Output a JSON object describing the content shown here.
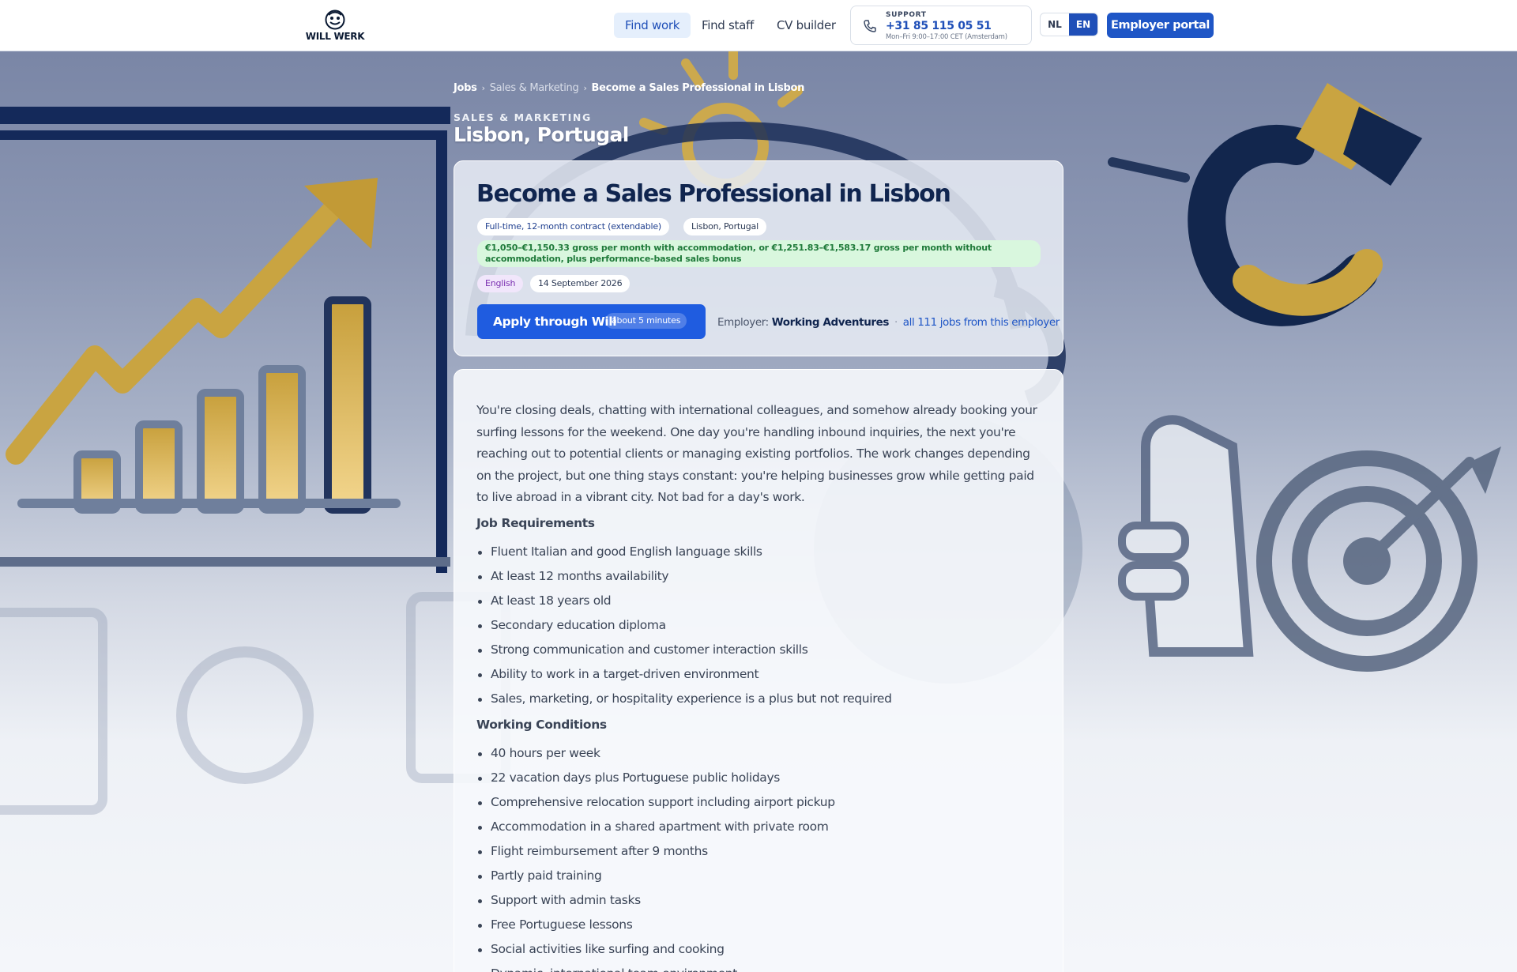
{
  "header": {
    "logo_text": "WILL WERK",
    "nav": [
      {
        "label": "Find work",
        "active": true
      },
      {
        "label": "Find staff",
        "active": false
      },
      {
        "label": "CV builder",
        "active": false
      }
    ],
    "support": {
      "label": "SUPPORT",
      "phone": "+31 85 115 05 51",
      "hours": "Mon–Fri 9:00–17:00 CET (Amsterdam)"
    },
    "languages": [
      "NL",
      "EN"
    ],
    "active_language": "EN",
    "employer_portal": "Employer portal"
  },
  "breadcrumb": {
    "jobs": "Jobs",
    "category": "Sales & Marketing",
    "current": "Become a Sales Professional in Lisbon",
    "separator": "›"
  },
  "hero": {
    "category": "SALES & MARKETING",
    "location": "Lisbon, Portugal"
  },
  "job": {
    "title": "Become a Sales Professional in Lisbon",
    "contract": "Full-time, 12-month contract (extendable)",
    "location": "Lisbon, Portugal",
    "salary": "€1,050–€1,150.33 gross per month with accommodation, or €1,251.83–€1,583.17 gross per month without accommodation, plus performance-based sales bonus",
    "language": "English",
    "date": "14 September 2026",
    "apply_label": "Apply through Will",
    "apply_time": "about 5 minutes",
    "employer_prefix": "Employer:",
    "employer_name": "Working Adventures",
    "employer_separator": "·",
    "employer_jobs": "all 111 jobs from this employer"
  },
  "description": {
    "intro": "You're closing deals, chatting with international colleagues, and somehow already booking your surfing lessons for the weekend. One day you're handling inbound inquiries, the next you're reaching out to potential clients or managing existing portfolios. The work changes depending on the project, but one thing stays constant: you're helping businesses grow while getting paid to live abroad in a vibrant city. Not bad for a day's work.",
    "requirements_heading": "Job Requirements",
    "requirements": [
      "Fluent Italian and good English language skills",
      "At least 12 months availability",
      "At least 18 years old",
      "Secondary education diploma",
      "Strong communication and customer interaction skills",
      "Ability to work in a target-driven environment",
      "Sales, marketing, or hospitality experience is a plus but not required"
    ],
    "conditions_heading": "Working Conditions",
    "conditions": [
      "40 hours per week",
      "22 vacation days plus Portuguese public holidays",
      "Comprehensive relocation support including airport pickup",
      "Accommodation in a shared apartment with private room",
      "Flight reimbursement after 9 months",
      "Partly paid training",
      "Support with admin tasks",
      "Free Portuguese lessons",
      "Social activities like surfing and cooking",
      "Dynamic, international team environment"
    ]
  },
  "colors": {
    "brand_blue": "#1f56c6",
    "navy": "#10254f",
    "salary_green": "#1f7a3a",
    "gold": "#c9a441"
  },
  "icons": [
    "logo-mascot-icon",
    "phone-icon",
    "breadcrumb-chevron-icon"
  ]
}
